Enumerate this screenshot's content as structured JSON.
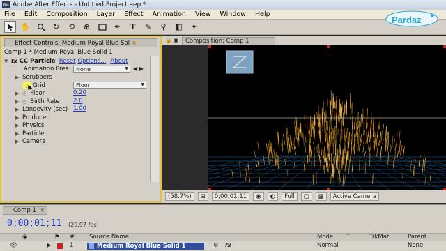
{
  "window": {
    "app_icon_text": "Ae",
    "title": "Adobe After Effects - Untitled Project.aep *"
  },
  "menu": [
    "File",
    "Edit",
    "Composition",
    "Layer",
    "Effect",
    "Animation",
    "View",
    "Window",
    "Help"
  ],
  "toolbar": {
    "tools": [
      "selection-tool-icon",
      "hand-tool-icon",
      "zoom-tool-icon",
      "rotate-tool-icon",
      "camera-tool-icon",
      "pan-behind-tool-icon",
      "rectangle-tool-icon",
      "pen-tool-icon",
      "type-tool-icon",
      "brush-tool-icon",
      "clone-stamp-tool-icon",
      "eraser-tool-icon",
      "puppet-pin-tool-icon"
    ]
  },
  "logo": {
    "text": "Pardaz"
  },
  "effect_controls": {
    "tab_label": "Effect Controls: Medium Royal Blue Sol",
    "path": "Comp 1 * Medium Royal Blue Solid 1",
    "effect_name": "CC Particle",
    "reset_label": "Reset",
    "options_label": "Options...",
    "about_label": "About",
    "animation_preset_label": "Animation Pres",
    "animation_preset_value": "None",
    "rows": {
      "scrubbers": "Scrubbers",
      "grid": "Grid",
      "grid_value": "Floor",
      "floor": "Floor",
      "floor_value": "0.20",
      "birth_rate": "Birth Rate",
      "birth_rate_value": "2.0",
      "longevity": "Longevity (sec)",
      "longevity_value": "1.00",
      "producer": "Producer",
      "physics": "Physics",
      "particle": "Particle",
      "camera": "Camera"
    }
  },
  "composition": {
    "tab_label": "Composition: Comp 1",
    "zoom": "(58.7%)",
    "timecode": "0;00;01;11",
    "resolution": "Full",
    "view": "Active Camera"
  },
  "timeline": {
    "tab_label": "Comp 1",
    "timecode": "0;00;01;11",
    "fps": "(29.97 fps)",
    "headers": {
      "num": "#",
      "source_name": "Source Name",
      "mode": "Mode",
      "t": "T",
      "trkmat": "TrkMat",
      "parent": "Parent"
    },
    "layer": {
      "num": "1",
      "name": "Medium Royal Blue Solid 1",
      "mode": "Normal",
      "parent": "None"
    },
    "colors": {
      "layer_label": "#cc2222",
      "layer_source": "#8aa8e8"
    }
  },
  "colors": {
    "panel_highlight": "#e6c23a",
    "link": "#1b39c9",
    "particle": "#f0a020",
    "floor_grid": "#2a6aa8"
  }
}
